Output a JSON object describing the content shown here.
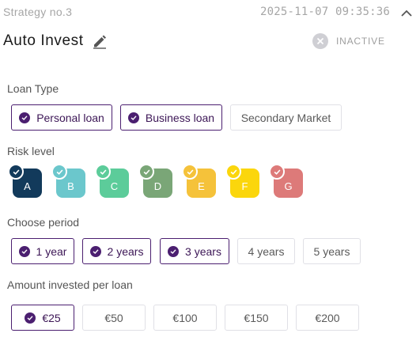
{
  "header": {
    "strategy_no": "Strategy no.3",
    "timestamp": "2025-11-07 09:35:36",
    "title": "Auto Invest",
    "status": "INACTIVE"
  },
  "loan_type": {
    "label": "Loan Type",
    "options": [
      {
        "label": "Personal loan",
        "selected": true
      },
      {
        "label": "Business loan",
        "selected": true
      },
      {
        "label": "Secondary Market",
        "selected": false
      }
    ]
  },
  "risk": {
    "label": "Risk level",
    "levels": [
      {
        "label": "A",
        "color": "#123a5b",
        "selected": true
      },
      {
        "label": "B",
        "color": "#6bc7cc",
        "selected": true
      },
      {
        "label": "C",
        "color": "#5ccc9a",
        "selected": true
      },
      {
        "label": "D",
        "color": "#7aa677",
        "selected": true
      },
      {
        "label": "E",
        "color": "#f5c23a",
        "selected": true
      },
      {
        "label": "F",
        "color": "#fbd60c",
        "selected": true
      },
      {
        "label": "G",
        "color": "#dd7a79",
        "selected": true
      }
    ]
  },
  "period": {
    "label": "Choose period",
    "options": [
      {
        "label": "1 year",
        "selected": true
      },
      {
        "label": "2 years",
        "selected": true
      },
      {
        "label": "3 years",
        "selected": true
      },
      {
        "label": "4 years",
        "selected": false
      },
      {
        "label": "5 years",
        "selected": false
      }
    ]
  },
  "amount": {
    "label": "Amount invested per loan",
    "options": [
      {
        "label": "€25",
        "selected": true
      },
      {
        "label": "€50",
        "selected": false
      },
      {
        "label": "€100",
        "selected": false
      },
      {
        "label": "€150",
        "selected": false
      },
      {
        "label": "€200",
        "selected": false
      }
    ]
  },
  "colors": {
    "accent": "#4b1f70",
    "muted": "#a6a6a6"
  }
}
